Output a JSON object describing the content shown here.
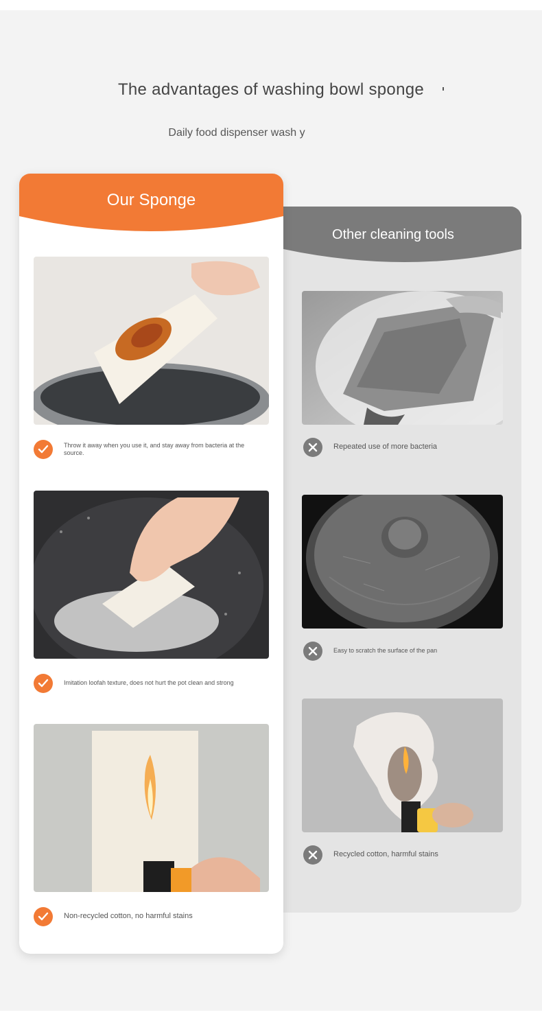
{
  "heading": {
    "title": "The advantages of washing bowl sponge",
    "subtitle": "Daily food dispenser wash y"
  },
  "colors": {
    "accent_orange": "#f27a35",
    "header_gray": "#7b7b7b",
    "page_background": "#f3f3f3"
  },
  "our_sponge": {
    "title": "Our Sponge",
    "features": [
      {
        "icon": "check-icon",
        "text": "Throw it away when you use it, and stay away from bacteria at the source."
      },
      {
        "icon": "check-icon",
        "text": "Imitation loofah texture, does not hurt the pot clean and strong"
      },
      {
        "icon": "check-icon",
        "text": "Non-recycled cotton, no harmful stains"
      }
    ]
  },
  "other_tools": {
    "title": "Other cleaning tools",
    "features": [
      {
        "icon": "x-icon",
        "text": "Repeated use of more bacteria"
      },
      {
        "icon": "x-icon",
        "text": "Easy to scratch the surface of the pan"
      },
      {
        "icon": "x-icon",
        "text": "Recycled cotton, harmful stains"
      }
    ]
  }
}
